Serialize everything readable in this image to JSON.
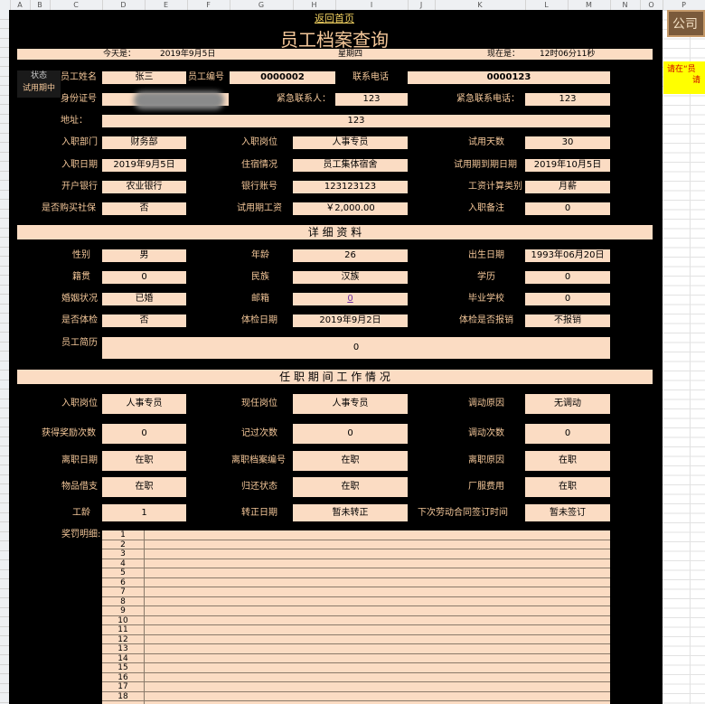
{
  "columns": [
    "A",
    "B",
    "C",
    "D",
    "E",
    "F",
    "G",
    "H",
    "I",
    "J",
    "K",
    "L",
    "M",
    "N",
    "O",
    "P"
  ],
  "return_link": "返回首页",
  "title": "员工档案查询",
  "dateline": {
    "today_label": "今天是：",
    "today_value": "2019年9月5日",
    "weekday": "星期四",
    "now_label": "现在是：",
    "now_value": "12时06分11秒"
  },
  "status": {
    "label": "状态",
    "value": "试用期中"
  },
  "basic": {
    "name_label": "员工姓名",
    "name_value": "张三",
    "id_label": "员工编号",
    "id_value": "0000002",
    "phone_label": "联系电话",
    "phone_value": "0000123",
    "idcard_label": "身份证号",
    "ec_label": "紧急联系人：",
    "ec_value": "123",
    "ecphone_label": "紧急联系电话：",
    "ecphone_value": "123",
    "address_label": "地址：",
    "address_value": "123"
  },
  "job": {
    "dept_label": "入职部门",
    "dept_value": "财务部",
    "post_label": "入职岗位",
    "post_value": "人事专员",
    "trialdays_label": "试用天数",
    "trialdays_value": "30",
    "entry_label": "入职日期",
    "entry_value": "2019年9月5日",
    "housing_label": "住宿情况",
    "housing_value": "员工集体宿舍",
    "trialend_label": "试用期到期日期",
    "trialend_value": "2019年10月5日",
    "bank_label": "开户银行",
    "bank_value": "农业银行",
    "account_label": "银行账号",
    "account_value": "123123123",
    "salarytype_label": "工资计算类别",
    "salarytype_value": "月薪",
    "insurance_label": "是否购买社保",
    "insurance_value": "否",
    "trialwage_label": "试用期工资",
    "trialwage_value": "￥2,000.00",
    "entrynote_label": "入职备注",
    "entrynote_value": "0"
  },
  "detail_header": "详 细 资 料",
  "detail": {
    "gender_label": "性别",
    "gender_value": "男",
    "age_label": "年龄",
    "age_value": "26",
    "birth_label": "出生日期",
    "birth_value": "1993年06月20日",
    "origin_label": "籍贯",
    "origin_value": "0",
    "ethnic_label": "民族",
    "ethnic_value": "汉族",
    "edu_label": "学历",
    "edu_value": "0",
    "marital_label": "婚姻状况",
    "marital_value": "已婚",
    "email_label": "邮箱",
    "email_value": "0",
    "school_label": "毕业学校",
    "school_value": "0",
    "exam_label": "是否体检",
    "exam_value": "否",
    "examdate_label": "体检日期",
    "examdate_value": "2019年9月2日",
    "reimb_label": "体检是否报销",
    "reimb_value": "不报销",
    "resume_label": "员工简历",
    "resume_value": "0"
  },
  "work_header": "任 职 期 间 工 作 情 况",
  "work": {
    "entrypost_label": "入职岗位",
    "entrypost_value": "人事专员",
    "curpost_label": "现任岗位",
    "curpost_value": "人事专员",
    "transreason_label": "调动原因",
    "transreason_value": "无调动",
    "awards_label": "获得奖励次数",
    "awards_value": "0",
    "demerits_label": "记过次数",
    "demerits_value": "0",
    "transfers_label": "调动次数",
    "transfers_value": "0",
    "leavedate_label": "离职日期",
    "leavedate_value": "在职",
    "leavefile_label": "离职档案编号",
    "leavefile_value": "在职",
    "leavereason_label": "离职原因",
    "leavereason_value": "在职",
    "items_label": "物品借支",
    "items_value": "在职",
    "returnstate_label": "归还状态",
    "returnstate_value": "在职",
    "uniform_label": "厂服费用",
    "uniform_value": "在职",
    "seniority_label": "工龄",
    "seniority_value": "1",
    "regular_label": "转正日期",
    "regular_value": "暂未转正",
    "contract_label": "下次劳动合同签订时间",
    "contract_value": "暂未签订"
  },
  "rewards_label": "奖罚明细:",
  "rewards_rows": [
    "1",
    "2",
    "3",
    "4",
    "5",
    "6",
    "7",
    "8",
    "9",
    "10",
    "11",
    "12",
    "13",
    "14",
    "15",
    "16",
    "17",
    "18"
  ],
  "right_panel": {
    "title": "公司",
    "note_line1": "请在“员",
    "note_line2": "请"
  }
}
